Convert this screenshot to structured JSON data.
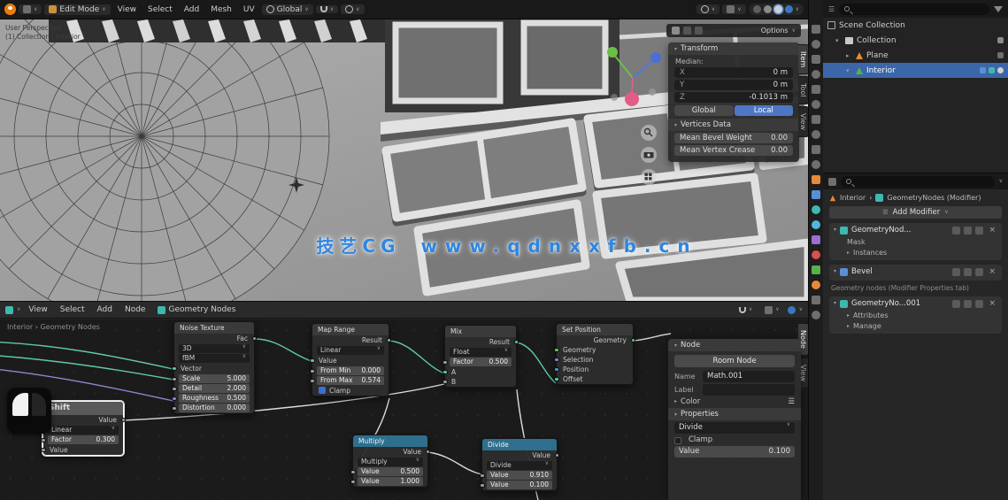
{
  "icons": {
    "chevron_down": "∨",
    "chevron_right": "›",
    "caret_right": "▸",
    "caret_down": "▾",
    "close": "×",
    "check": "✓",
    "menu": "☰"
  },
  "topbar": {
    "mode": "Edit Mode",
    "menus": [
      "View",
      "Select",
      "Add",
      "Mesh",
      "UV"
    ],
    "orientation": "Global",
    "options_label": "Options"
  },
  "viewport": {
    "info_lines": [
      "User Perspective",
      "(1) Collection | Interior"
    ],
    "npanel": {
      "tabs": [
        "Item",
        "Tool",
        "View"
      ],
      "transform_title": "Transform",
      "median_label": "Median:",
      "axes": [
        {
          "axis": "X",
          "value": "0 m"
        },
        {
          "axis": "Y",
          "value": "0 m"
        },
        {
          "axis": "Z",
          "value": "-0.1013 m"
        }
      ],
      "global_button": "Global",
      "local_button": "Local",
      "vertices_title": "Vertices Data",
      "fields": [
        {
          "label": "Mean Bevel Weight",
          "value": "0.00"
        },
        {
          "label": "Mean Vertex Crease",
          "value": "0.00"
        }
      ]
    }
  },
  "watermark": {
    "brand": "技艺CG",
    "url": "www.qdnxxfb.cn"
  },
  "outliner": {
    "rows": [
      {
        "label": "Scene Collection"
      },
      {
        "label": "Collection"
      },
      {
        "label": "Plane"
      },
      {
        "label": "Interior"
      }
    ]
  },
  "properties": {
    "breadcrumb": {
      "object": "Interior",
      "context": "GeometryNodes (Modifier)"
    },
    "add_modifier_label": "Add Modifier",
    "modifiers": [
      {
        "name": "GeometryNod...",
        "rows": [
          "Mask",
          "Instances"
        ]
      },
      {
        "name": "Bevel",
        "rows": []
      },
      {
        "name": "GeometryNo...001",
        "rows": [
          "Attributes",
          "Manage"
        ]
      }
    ],
    "caption": "Geometry nodes (Modifier Properties tab)"
  },
  "node_editor": {
    "menus": [
      "View",
      "Select",
      "Add",
      "Node"
    ],
    "tree_name": "Geometry Nodes",
    "breadcrumb": "Interior › Geometry Nodes",
    "nodes": {
      "shift": {
        "title": "Shift",
        "out": "Value",
        "menu": "Linear",
        "slider_label": "Factor",
        "slider_value": "0.300",
        "input": "Value"
      },
      "noise": {
        "title": "Noise Texture",
        "out": "Fac",
        "menu1": "3D",
        "menu2": "fBM",
        "rows": [
          {
            "label": "Vector",
            "value": ""
          },
          {
            "label": "Scale",
            "value": "5.000"
          },
          {
            "label": "Detail",
            "value": "2.000"
          },
          {
            "label": "Roughness",
            "value": "0.500"
          },
          {
            "label": "Distortion",
            "value": "0.000"
          }
        ]
      },
      "map_range": {
        "title": "Map Range",
        "out": "Result",
        "menu": "Linear",
        "rows": [
          {
            "label": "Value",
            "value": ""
          },
          {
            "label": "From Min",
            "value": "0.000"
          },
          {
            "label": "From Max",
            "value": "0.574"
          }
        ],
        "clamp_label": "Clamp"
      },
      "mix": {
        "title": "Mix",
        "out": "Result",
        "menu": "Float",
        "rows": [
          {
            "label": "Factor",
            "value": "0.500"
          },
          {
            "label": "A",
            "value": ""
          },
          {
            "label": "B",
            "value": ""
          }
        ]
      },
      "set_position": {
        "title": "Set Position",
        "out": "Geometry",
        "rows": [
          {
            "label": "Geometry",
            "value": ""
          },
          {
            "label": "Selection",
            "value": ""
          },
          {
            "label": "Position",
            "value": ""
          },
          {
            "label": "Offset",
            "value": ""
          }
        ]
      },
      "math1": {
        "title": "Multiply",
        "out": "Value",
        "menu": "Multiply",
        "rows": [
          {
            "label": "Value",
            "value": "0.500"
          },
          {
            "label": "Value",
            "value": "1.000"
          }
        ]
      },
      "math2": {
        "title": "Divide",
        "out": "Value",
        "menu": "Divide",
        "rows": [
          {
            "label": "Value",
            "value": "0.910"
          },
          {
            "label": "Value",
            "value": "0.100"
          }
        ]
      }
    },
    "npanel": {
      "tabs": [
        "Node",
        "View"
      ],
      "node_title": "Node",
      "node_button": "Room Node",
      "name_label": "Name",
      "name_value": "Math.001",
      "label_label": "Label",
      "label_value": "",
      "color_label": "Color",
      "properties_title": "Properties",
      "operation_value": "Divide",
      "clamp_label": "Clamp",
      "value_label": "Value",
      "value_value": "0.100"
    }
  },
  "colors": {
    "accent_blue": "#4f76c4",
    "selection_blue": "#3b66a8",
    "wire_teal": "#5fc9a8",
    "node_header_converter": "#2e6f8e",
    "object_orange": "#e8883a",
    "watermark_blue": "#2f86e0"
  }
}
